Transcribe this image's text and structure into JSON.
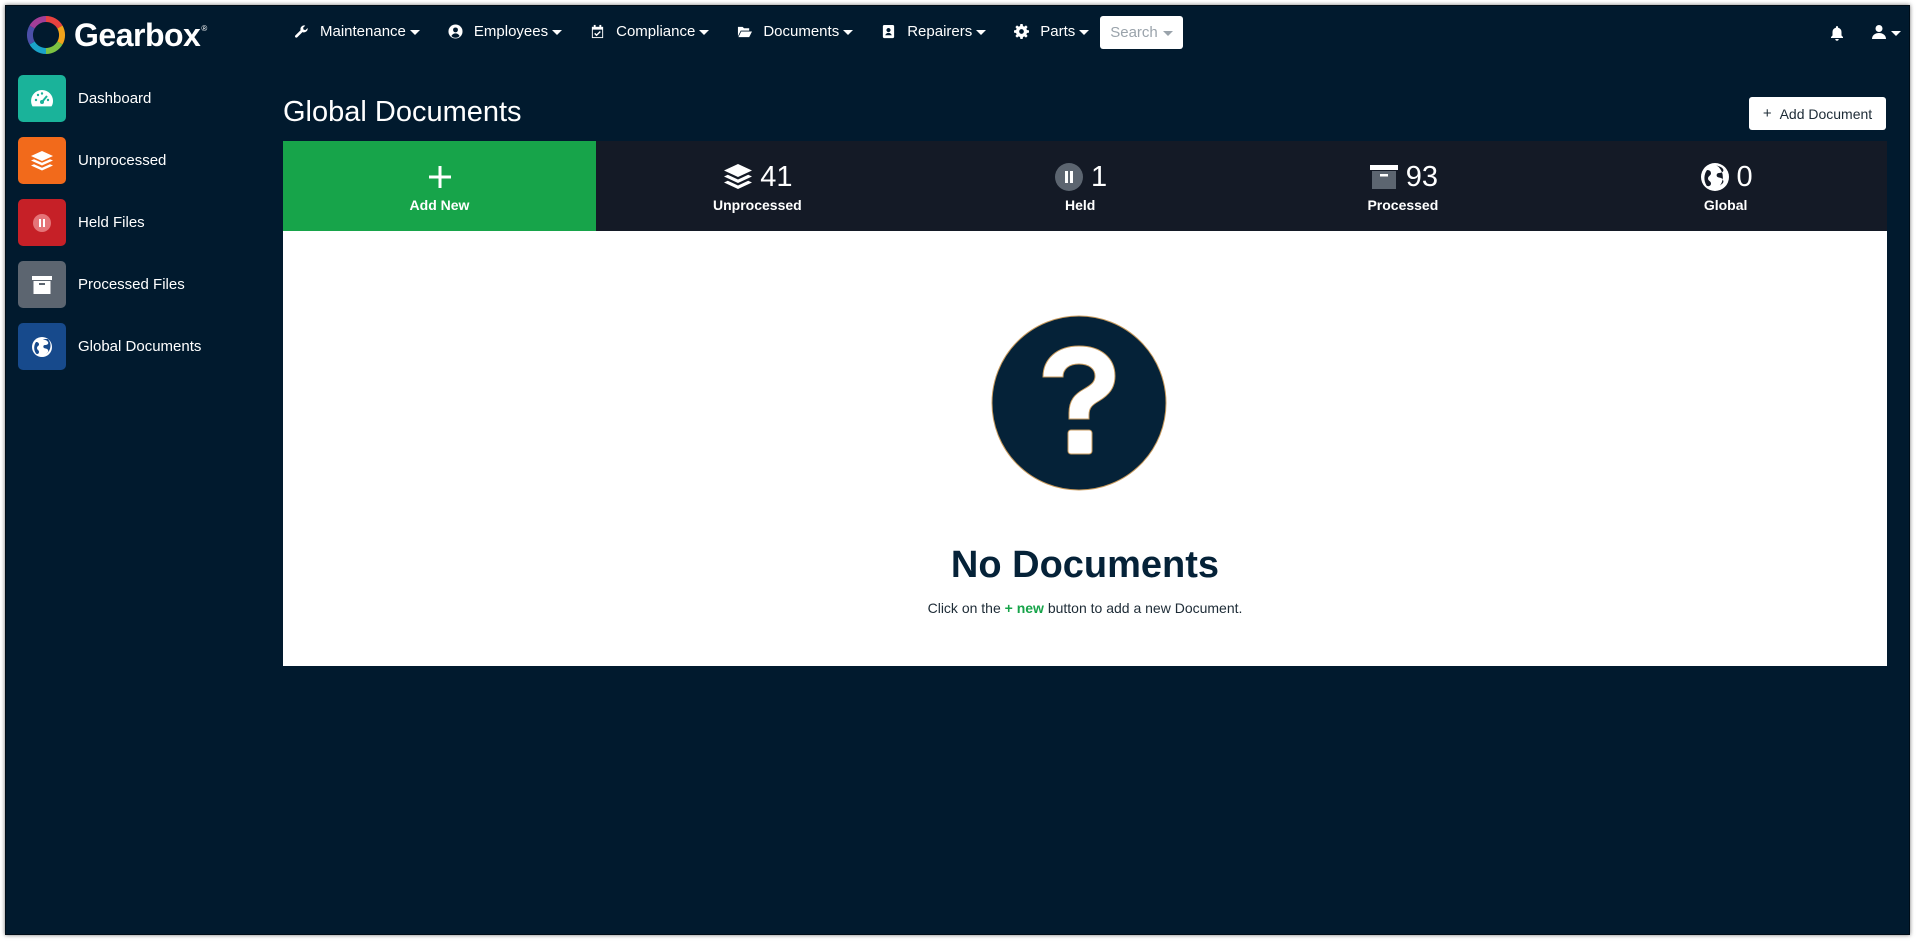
{
  "brand": {
    "name": "Gearbox",
    "mark": "®"
  },
  "nav": {
    "items": [
      {
        "label": "Maintenance",
        "icon": "wrench-icon"
      },
      {
        "label": "Employees",
        "icon": "user-circle-icon"
      },
      {
        "label": "Compliance",
        "icon": "calendar-check-icon"
      },
      {
        "label": "Documents",
        "icon": "folder-open-icon"
      },
      {
        "label": "Repairers",
        "icon": "contact-card-icon"
      },
      {
        "label": "Parts",
        "icon": "gear-icon"
      }
    ],
    "search_label": "Search"
  },
  "sidebar": {
    "items": [
      {
        "label": "Dashboard",
        "icon": "dashboard-gauge-icon",
        "color": "#1ab39a"
      },
      {
        "label": "Unprocessed",
        "icon": "layers-icon",
        "color": "#f26a1b"
      },
      {
        "label": "Held Files",
        "icon": "pause-icon",
        "color": "#c62027"
      },
      {
        "label": "Processed Files",
        "icon": "archive-icon",
        "color": "#5c6570"
      },
      {
        "label": "Global Documents",
        "icon": "globe-icon",
        "color": "#174a8c"
      }
    ]
  },
  "main": {
    "title": "Global Documents",
    "add_button": {
      "plus": "+",
      "label": "Add Document"
    },
    "stats": [
      {
        "label": "Add New",
        "count": "",
        "icon": "plus-icon"
      },
      {
        "label": "Unprocessed",
        "count": "41",
        "icon": "layers-icon"
      },
      {
        "label": "Held",
        "count": "1",
        "icon": "pause-icon"
      },
      {
        "label": "Processed",
        "count": "93",
        "icon": "archive-icon"
      },
      {
        "label": "Global",
        "count": "0",
        "icon": "globe-icon"
      }
    ],
    "empty": {
      "icon": "question-circle-icon",
      "title": "No Documents",
      "sub_before": "Click on the ",
      "sub_highlight": "+ new",
      "sub_after": " button to add a new Document."
    }
  },
  "colors": {
    "background": "#011a2e",
    "stats_bar": "#141a26",
    "accent_green": "#17a44a",
    "empty_icon": "#052238"
  }
}
